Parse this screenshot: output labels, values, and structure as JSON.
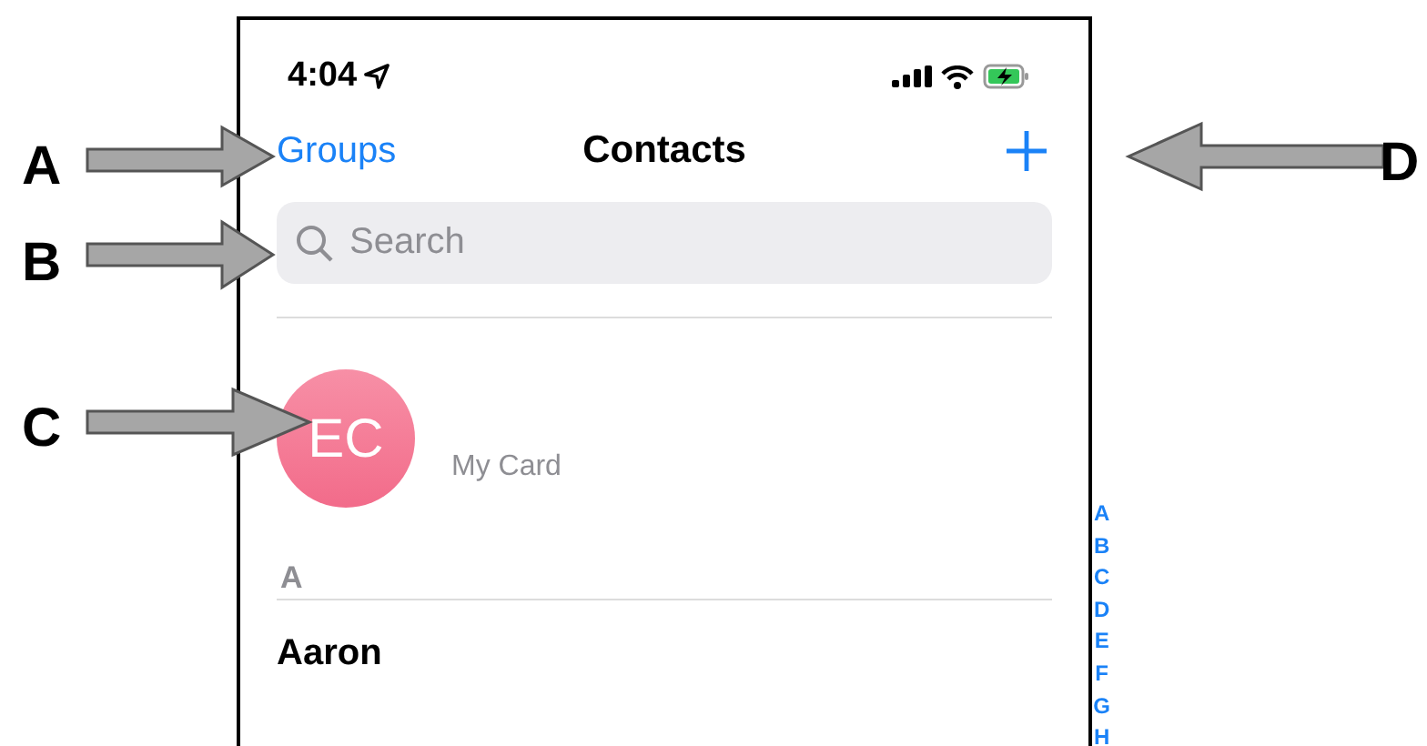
{
  "status_bar": {
    "time": "4:04"
  },
  "nav": {
    "left_button": "Groups",
    "title": "Contacts"
  },
  "search": {
    "placeholder": "Search"
  },
  "my_card": {
    "initials": "EC",
    "subtitle": "My Card"
  },
  "sections": [
    {
      "header": "A",
      "contacts": [
        "Aaron"
      ]
    }
  ],
  "index_letters": [
    "A",
    "B",
    "C",
    "D",
    "E",
    "F",
    "G",
    "H"
  ],
  "annotations": [
    {
      "label": "A"
    },
    {
      "label": "B"
    },
    {
      "label": "C"
    },
    {
      "label": "D"
    }
  ]
}
